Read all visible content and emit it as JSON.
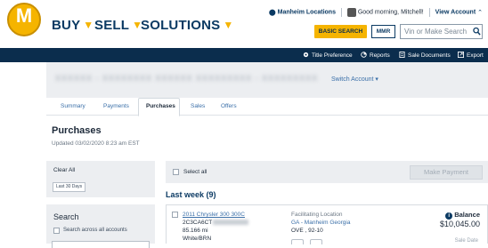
{
  "brand": {
    "logo_letter": "M",
    "accent": "#f5b400",
    "navy": "#0b2d4d"
  },
  "nav": [
    {
      "label": "BUY"
    },
    {
      "label": "SELL"
    },
    {
      "label": "SOLUTIONS"
    }
  ],
  "topbar": {
    "location": "Manheim Locations",
    "greeting": "Good morning, Mitchell!",
    "view_account": "View Account"
  },
  "actions": {
    "basic_search": "BASIC SEARCH",
    "mmr": "MMR"
  },
  "search": {
    "placeholder": "Vin or Make Search"
  },
  "darkbar": {
    "items": [
      "Title Preference",
      "Reports",
      "Sale Documents",
      "Export"
    ]
  },
  "account": {
    "name": "XXXXXX - XXXXXXXX XXXXXX XXXXXXXXX - XXXXXXXXX",
    "switch_label": "Switch Account"
  },
  "tabs": [
    "Summary",
    "Payments",
    "Purchases",
    "Sales",
    "Offers"
  ],
  "page": {
    "title": "Purchases",
    "updated": "Updated 03/02/2020 8:23 am EST"
  },
  "filters": {
    "clear_all": "Clear All",
    "chip": "Last 30 Days",
    "search_heading": "Search",
    "search_all_label": "Search across all accounts"
  },
  "list": {
    "select_all": "Select all",
    "make_payment": "Make Payment",
    "group_heading": "Last week (9)"
  },
  "vehicle": {
    "title": "2011 Chrysler 300 300C",
    "vin_prefix": "2C3CA6CT",
    "mileage": "85.166 mi",
    "color": "White/BRN",
    "fac_heading": "Facilitating Location",
    "fac_location": "GA - Manheim Georgia",
    "fac_sub": "OVE , 92-10",
    "balance_heading": "Balance",
    "balance_value": "$10,045.00",
    "sale_date_label": "Sale Date"
  }
}
